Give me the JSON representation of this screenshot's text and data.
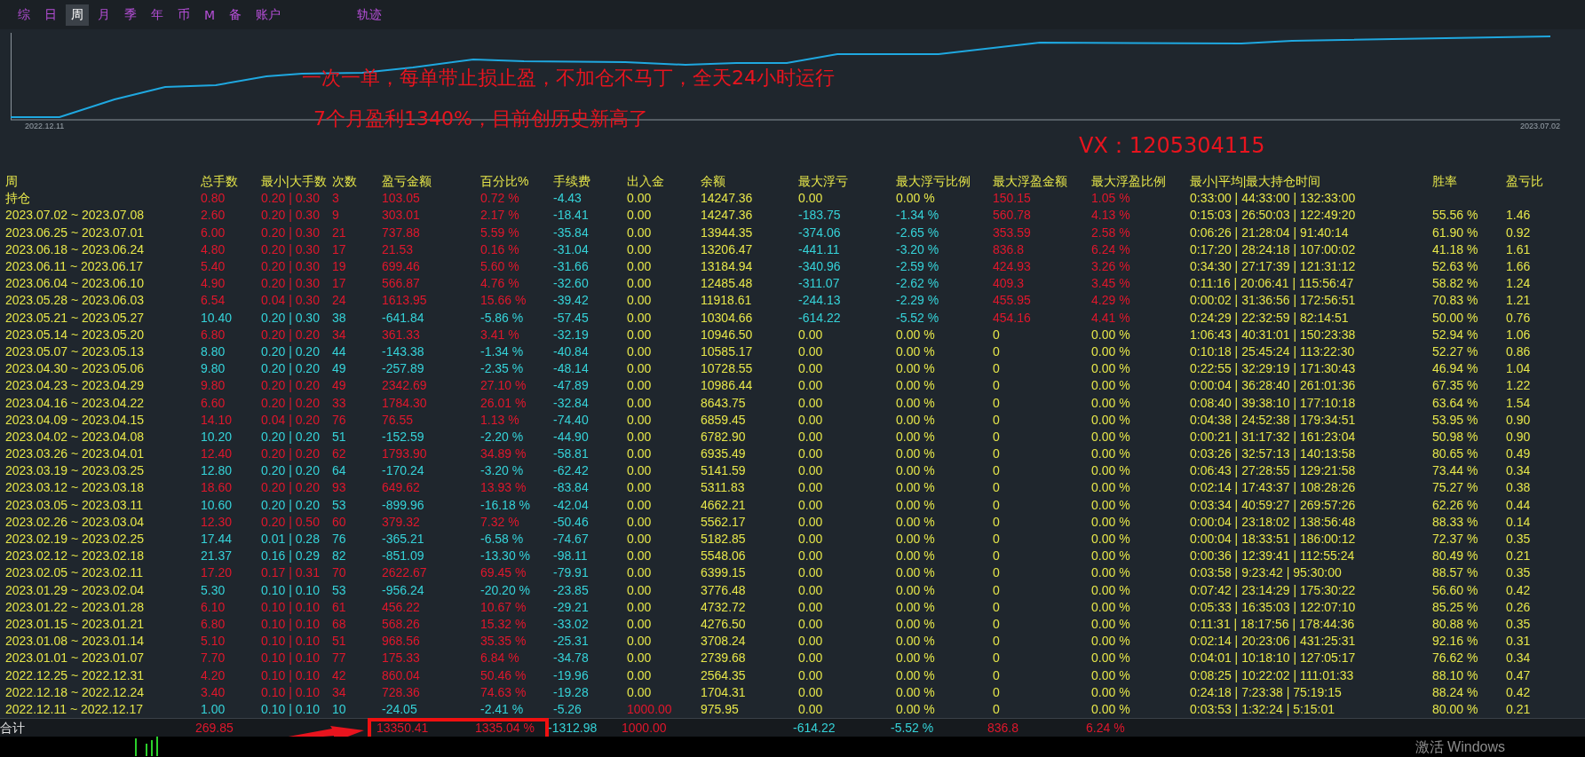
{
  "tabs": [
    {
      "label": "综",
      "selected": false
    },
    {
      "label": "日",
      "selected": false
    },
    {
      "label": "周",
      "selected": true
    },
    {
      "label": "月",
      "selected": false
    },
    {
      "label": "季",
      "selected": false
    },
    {
      "label": "年",
      "selected": false
    },
    {
      "label": "币",
      "selected": false
    },
    {
      "label": "M",
      "selected": false
    },
    {
      "label": "备",
      "selected": false
    },
    {
      "label": "账户",
      "selected": false
    },
    {
      "label": "轨迹",
      "selected": false
    }
  ],
  "chart": {
    "start_label": "2022.12.11",
    "end_label": "2023.07.02"
  },
  "annotations": [
    "一次一单，每单带止损止盈，不加仓不马丁，全天24小时运行",
    "7个月盈利1340%，目前创历史新高了",
    "VX：1205304115"
  ],
  "columns": [
    {
      "label": "周",
      "kind": "label"
    },
    {
      "label": "总手数",
      "kind": "result"
    },
    {
      "label": "最小|大手数",
      "kind": "result"
    },
    {
      "label": "次数",
      "kind": "result"
    },
    {
      "label": "盈亏金额",
      "kind": "result"
    },
    {
      "label": "百分比%",
      "kind": "result"
    },
    {
      "label": "手续费",
      "kind": "fee"
    },
    {
      "label": "出入金",
      "kind": "cash"
    },
    {
      "label": "余额",
      "kind": "plain"
    },
    {
      "label": "最大浮亏",
      "kind": "floatloss"
    },
    {
      "label": "最大浮亏比例",
      "kind": "floatloss"
    },
    {
      "label": "最大浮盈金额",
      "kind": "floatprofit"
    },
    {
      "label": "最大浮盈比例",
      "kind": "floatprofit"
    },
    {
      "label": "最小|平均|最大持仓时间",
      "kind": "plain"
    },
    {
      "label": "胜率",
      "kind": "plain"
    },
    {
      "label": "盈亏比",
      "kind": "plain"
    }
  ],
  "rows": [
    {
      "kind": "profit",
      "float_loss": false,
      "float_profit": true,
      "deposit": false,
      "cells": [
        "持仓",
        "0.80",
        "0.20 | 0.30",
        "3",
        "103.05",
        "0.72 %",
        "-4.43",
        "0.00",
        "14247.36",
        "0.00",
        "0.00 %",
        "150.15",
        "1.05 %",
        "0:33:00 | 44:33:00 | 132:33:00",
        null,
        null
      ]
    },
    {
      "kind": "profit",
      "float_loss": true,
      "float_profit": true,
      "deposit": false,
      "cells": [
        "2023.07.02 ~ 2023.07.08",
        "2.60",
        "0.20 | 0.30",
        "9",
        "303.01",
        "2.17 %",
        "-18.41",
        "0.00",
        "14247.36",
        "-183.75",
        "-1.34 %",
        "560.78",
        "4.13 %",
        "0:15:03 | 26:50:03 | 122:49:20",
        "55.56 %",
        "1.46"
      ]
    },
    {
      "kind": "profit",
      "float_loss": true,
      "float_profit": true,
      "deposit": false,
      "cells": [
        "2023.06.25 ~ 2023.07.01",
        "6.00",
        "0.20 | 0.30",
        "21",
        "737.88",
        "5.59 %",
        "-35.84",
        "0.00",
        "13944.35",
        "-374.06",
        "-2.65 %",
        "353.59",
        "2.58 %",
        "0:06:26 | 21:28:04 | 91:40:14",
        "61.90 %",
        "0.92"
      ]
    },
    {
      "kind": "profit",
      "float_loss": true,
      "float_profit": true,
      "deposit": false,
      "cells": [
        "2023.06.18 ~ 2023.06.24",
        "4.80",
        "0.20 | 0.30",
        "17",
        "21.53",
        "0.16 %",
        "-31.04",
        "0.00",
        "13206.47",
        "-441.11",
        "-3.20 %",
        "836.8",
        "6.24 %",
        "0:17:20 | 28:24:18 | 107:00:02",
        "41.18 %",
        "1.61"
      ]
    },
    {
      "kind": "profit",
      "float_loss": true,
      "float_profit": true,
      "deposit": false,
      "cells": [
        "2023.06.11 ~ 2023.06.17",
        "5.40",
        "0.20 | 0.30",
        "19",
        "699.46",
        "5.60 %",
        "-31.66",
        "0.00",
        "13184.94",
        "-340.96",
        "-2.59 %",
        "424.93",
        "3.26 %",
        "0:34:30 | 27:17:39 | 121:31:12",
        "52.63 %",
        "1.66"
      ]
    },
    {
      "kind": "profit",
      "float_loss": true,
      "float_profit": true,
      "deposit": false,
      "cells": [
        "2023.06.04 ~ 2023.06.10",
        "4.90",
        "0.20 | 0.30",
        "17",
        "566.87",
        "4.76 %",
        "-32.60",
        "0.00",
        "12485.48",
        "-311.07",
        "-2.62 %",
        "409.3",
        "3.45 %",
        "0:11:16 | 20:06:41 | 115:56:47",
        "58.82 %",
        "1.24"
      ]
    },
    {
      "kind": "profit",
      "float_loss": true,
      "float_profit": true,
      "deposit": false,
      "cells": [
        "2023.05.28 ~ 2023.06.03",
        "6.54",
        "0.04 | 0.30",
        "24",
        "1613.95",
        "15.66 %",
        "-39.42",
        "0.00",
        "11918.61",
        "-244.13",
        "-2.29 %",
        "455.95",
        "4.29 %",
        "0:00:02 | 31:36:56 | 172:56:51",
        "70.83 %",
        "1.21"
      ]
    },
    {
      "kind": "loss",
      "float_loss": true,
      "float_profit": true,
      "deposit": false,
      "cells": [
        "2023.05.21 ~ 2023.05.27",
        "10.40",
        "0.20 | 0.30",
        "38",
        "-641.84",
        "-5.86 %",
        "-57.45",
        "0.00",
        "10304.66",
        "-614.22",
        "-5.52 %",
        "454.16",
        "4.41 %",
        "0:24:29 | 22:32:59 | 82:14:51",
        "50.00 %",
        "0.76"
      ]
    },
    {
      "kind": "profit",
      "float_loss": false,
      "float_profit": false,
      "deposit": false,
      "cells": [
        "2023.05.14 ~ 2023.05.20",
        "6.80",
        "0.20 | 0.20",
        "34",
        "361.33",
        "3.41 %",
        "-32.19",
        "0.00",
        "10946.50",
        "0.00",
        "0.00 %",
        "0",
        "0.00 %",
        "1:06:43 | 40:31:01 | 150:23:38",
        "52.94 %",
        "1.06"
      ]
    },
    {
      "kind": "loss",
      "float_loss": false,
      "float_profit": false,
      "deposit": false,
      "cells": [
        "2023.05.07 ~ 2023.05.13",
        "8.80",
        "0.20 | 0.20",
        "44",
        "-143.38",
        "-1.34 %",
        "-40.84",
        "0.00",
        "10585.17",
        "0.00",
        "0.00 %",
        "0",
        "0.00 %",
        "0:10:18 | 25:45:24 | 113:22:30",
        "52.27 %",
        "0.86"
      ]
    },
    {
      "kind": "loss",
      "float_loss": false,
      "float_profit": false,
      "deposit": false,
      "cells": [
        "2023.04.30 ~ 2023.05.06",
        "9.80",
        "0.20 | 0.20",
        "49",
        "-257.89",
        "-2.35 %",
        "-48.14",
        "0.00",
        "10728.55",
        "0.00",
        "0.00 %",
        "0",
        "0.00 %",
        "0:22:55 | 32:29:19 | 171:30:43",
        "46.94 %",
        "1.04"
      ]
    },
    {
      "kind": "profit",
      "float_loss": false,
      "float_profit": false,
      "deposit": false,
      "cells": [
        "2023.04.23 ~ 2023.04.29",
        "9.80",
        "0.20 | 0.20",
        "49",
        "2342.69",
        "27.10 %",
        "-47.89",
        "0.00",
        "10986.44",
        "0.00",
        "0.00 %",
        "0",
        "0.00 %",
        "0:00:04 | 36:28:40 | 261:01:36",
        "67.35 %",
        "1.22"
      ]
    },
    {
      "kind": "profit",
      "float_loss": false,
      "float_profit": false,
      "deposit": false,
      "cells": [
        "2023.04.16 ~ 2023.04.22",
        "6.60",
        "0.20 | 0.20",
        "33",
        "1784.30",
        "26.01 %",
        "-32.84",
        "0.00",
        "8643.75",
        "0.00",
        "0.00 %",
        "0",
        "0.00 %",
        "0:08:40 | 39:38:10 | 177:10:18",
        "63.64 %",
        "1.54"
      ]
    },
    {
      "kind": "profit",
      "float_loss": false,
      "float_profit": false,
      "deposit": false,
      "cells": [
        "2023.04.09 ~ 2023.04.15",
        "14.10",
        "0.04 | 0.20",
        "76",
        "76.55",
        "1.13 %",
        "-74.40",
        "0.00",
        "6859.45",
        "0.00",
        "0.00 %",
        "0",
        "0.00 %",
        "0:04:38 | 24:52:38 | 179:34:51",
        "53.95 %",
        "0.90"
      ]
    },
    {
      "kind": "loss",
      "float_loss": false,
      "float_profit": false,
      "deposit": false,
      "cells": [
        "2023.04.02 ~ 2023.04.08",
        "10.20",
        "0.20 | 0.20",
        "51",
        "-152.59",
        "-2.20 %",
        "-44.90",
        "0.00",
        "6782.90",
        "0.00",
        "0.00 %",
        "0",
        "0.00 %",
        "0:00:21 | 31:17:32 | 161:23:04",
        "50.98 %",
        "0.90"
      ]
    },
    {
      "kind": "profit",
      "float_loss": false,
      "float_profit": false,
      "deposit": false,
      "cells": [
        "2023.03.26 ~ 2023.04.01",
        "12.40",
        "0.20 | 0.20",
        "62",
        "1793.90",
        "34.89 %",
        "-58.81",
        "0.00",
        "6935.49",
        "0.00",
        "0.00 %",
        "0",
        "0.00 %",
        "0:03:26 | 32:57:13 | 140:13:58",
        "80.65 %",
        "0.49"
      ]
    },
    {
      "kind": "loss",
      "float_loss": false,
      "float_profit": false,
      "deposit": false,
      "cells": [
        "2023.03.19 ~ 2023.03.25",
        "12.80",
        "0.20 | 0.20",
        "64",
        "-170.24",
        "-3.20 %",
        "-62.42",
        "0.00",
        "5141.59",
        "0.00",
        "0.00 %",
        "0",
        "0.00 %",
        "0:06:43 | 27:28:55 | 129:21:58",
        "73.44 %",
        "0.34"
      ]
    },
    {
      "kind": "profit",
      "float_loss": false,
      "float_profit": false,
      "deposit": false,
      "cells": [
        "2023.03.12 ~ 2023.03.18",
        "18.60",
        "0.20 | 0.20",
        "93",
        "649.62",
        "13.93 %",
        "-83.84",
        "0.00",
        "5311.83",
        "0.00",
        "0.00 %",
        "0",
        "0.00 %",
        "0:02:14 | 17:43:37 | 108:28:26",
        "75.27 %",
        "0.38"
      ]
    },
    {
      "kind": "loss",
      "float_loss": false,
      "float_profit": false,
      "deposit": false,
      "cells": [
        "2023.03.05 ~ 2023.03.11",
        "10.60",
        "0.20 | 0.20",
        "53",
        "-899.96",
        "-16.18 %",
        "-42.04",
        "0.00",
        "4662.21",
        "0.00",
        "0.00 %",
        "0",
        "0.00 %",
        "0:03:34 | 40:59:27 | 269:57:26",
        "62.26 %",
        "0.44"
      ]
    },
    {
      "kind": "profit",
      "float_loss": false,
      "float_profit": false,
      "deposit": false,
      "cells": [
        "2023.02.26 ~ 2023.03.04",
        "12.30",
        "0.20 | 0.50",
        "60",
        "379.32",
        "7.32 %",
        "-50.46",
        "0.00",
        "5562.17",
        "0.00",
        "0.00 %",
        "0",
        "0.00 %",
        "0:00:04 | 23:18:02 | 138:56:48",
        "88.33 %",
        "0.14"
      ]
    },
    {
      "kind": "loss",
      "float_loss": false,
      "float_profit": false,
      "deposit": false,
      "cells": [
        "2023.02.19 ~ 2023.02.25",
        "17.44",
        "0.01 | 0.28",
        "76",
        "-365.21",
        "-6.58 %",
        "-74.67",
        "0.00",
        "5182.85",
        "0.00",
        "0.00 %",
        "0",
        "0.00 %",
        "0:00:04 | 18:33:51 | 186:00:12",
        "72.37 %",
        "0.35"
      ]
    },
    {
      "kind": "loss",
      "float_loss": false,
      "float_profit": false,
      "deposit": false,
      "cells": [
        "2023.02.12 ~ 2023.02.18",
        "21.37",
        "0.16 | 0.29",
        "82",
        "-851.09",
        "-13.30 %",
        "-98.11",
        "0.00",
        "5548.06",
        "0.00",
        "0.00 %",
        "0",
        "0.00 %",
        "0:00:36 | 12:39:41 | 112:55:24",
        "80.49 %",
        "0.21"
      ]
    },
    {
      "kind": "profit",
      "float_loss": false,
      "float_profit": false,
      "deposit": false,
      "cells": [
        "2023.02.05 ~ 2023.02.11",
        "17.20",
        "0.17 | 0.31",
        "70",
        "2622.67",
        "69.45 %",
        "-79.91",
        "0.00",
        "6399.15",
        "0.00",
        "0.00 %",
        "0",
        "0.00 %",
        "0:03:58 | 9:23:42 | 95:30:00",
        "88.57 %",
        "0.35"
      ]
    },
    {
      "kind": "loss",
      "float_loss": false,
      "float_profit": false,
      "deposit": false,
      "cells": [
        "2023.01.29 ~ 2023.02.04",
        "5.30",
        "0.10 | 0.10",
        "53",
        "-956.24",
        "-20.20 %",
        "-23.85",
        "0.00",
        "3776.48",
        "0.00",
        "0.00 %",
        "0",
        "0.00 %",
        "0:07:42 | 23:14:29 | 175:30:22",
        "56.60 %",
        "0.42"
      ]
    },
    {
      "kind": "profit",
      "float_loss": false,
      "float_profit": false,
      "deposit": false,
      "cells": [
        "2023.01.22 ~ 2023.01.28",
        "6.10",
        "0.10 | 0.10",
        "61",
        "456.22",
        "10.67 %",
        "-29.21",
        "0.00",
        "4732.72",
        "0.00",
        "0.00 %",
        "0",
        "0.00 %",
        "0:05:33 | 16:35:03 | 122:07:10",
        "85.25 %",
        "0.26"
      ]
    },
    {
      "kind": "profit",
      "float_loss": false,
      "float_profit": false,
      "deposit": false,
      "cells": [
        "2023.01.15 ~ 2023.01.21",
        "6.80",
        "0.10 | 0.10",
        "68",
        "568.26",
        "15.32 %",
        "-33.02",
        "0.00",
        "4276.50",
        "0.00",
        "0.00 %",
        "0",
        "0.00 %",
        "0:11:31 | 18:17:56 | 178:44:36",
        "80.88 %",
        "0.35"
      ]
    },
    {
      "kind": "profit",
      "float_loss": false,
      "float_profit": false,
      "deposit": false,
      "cells": [
        "2023.01.08 ~ 2023.01.14",
        "5.10",
        "0.10 | 0.10",
        "51",
        "968.56",
        "35.35 %",
        "-25.31",
        "0.00",
        "3708.24",
        "0.00",
        "0.00 %",
        "0",
        "0.00 %",
        "0:02:14 | 20:23:06 | 431:25:31",
        "92.16 %",
        "0.31"
      ]
    },
    {
      "kind": "profit",
      "float_loss": false,
      "float_profit": false,
      "deposit": false,
      "cells": [
        "2023.01.01 ~ 2023.01.07",
        "7.70",
        "0.10 | 0.10",
        "77",
        "175.33",
        "6.84 %",
        "-34.78",
        "0.00",
        "2739.68",
        "0.00",
        "0.00 %",
        "0",
        "0.00 %",
        "0:04:01 | 10:18:10 | 127:05:17",
        "76.62 %",
        "0.34"
      ]
    },
    {
      "kind": "profit",
      "float_loss": false,
      "float_profit": false,
      "deposit": false,
      "cells": [
        "2022.12.25 ~ 2022.12.31",
        "4.20",
        "0.10 | 0.10",
        "42",
        "860.04",
        "50.46 %",
        "-19.96",
        "0.00",
        "2564.35",
        "0.00",
        "0.00 %",
        "0",
        "0.00 %",
        "0:08:25 | 10:22:02 | 111:01:33",
        "88.10 %",
        "0.47"
      ]
    },
    {
      "kind": "profit",
      "float_loss": false,
      "float_profit": false,
      "deposit": false,
      "cells": [
        "2022.12.18 ~ 2022.12.24",
        "3.40",
        "0.10 | 0.10",
        "34",
        "728.36",
        "74.63 %",
        "-19.28",
        "0.00",
        "1704.31",
        "0.00",
        "0.00 %",
        "0",
        "0.00 %",
        "0:24:18 | 7:23:38 | 75:19:15",
        "88.24 %",
        "0.42"
      ]
    },
    {
      "kind": "loss",
      "float_loss": false,
      "float_profit": false,
      "deposit": true,
      "cells": [
        "2022.12.11 ~ 2022.12.17",
        "1.00",
        "0.10 | 0.10",
        "10",
        "-24.05",
        "-2.41 %",
        "-5.26",
        "1000.00",
        "975.95",
        "0.00",
        "0.00 %",
        "0",
        "0.00 %",
        "0:03:53 | 1:32:24 | 5:15:01",
        "80.00 %",
        "0.21"
      ]
    }
  ],
  "total": {
    "kind": "profit",
    "float_loss": true,
    "float_profit": true,
    "deposit": true,
    "cells": [
      "合计",
      "269.85",
      null,
      null,
      "13350.41",
      "1335.04 %",
      "-1312.98",
      "1000.00",
      null,
      "-614.22",
      "-5.52 %",
      "836.8",
      "6.24 %",
      null,
      null,
      null
    ]
  },
  "os_notice": "激活 Windows"
}
